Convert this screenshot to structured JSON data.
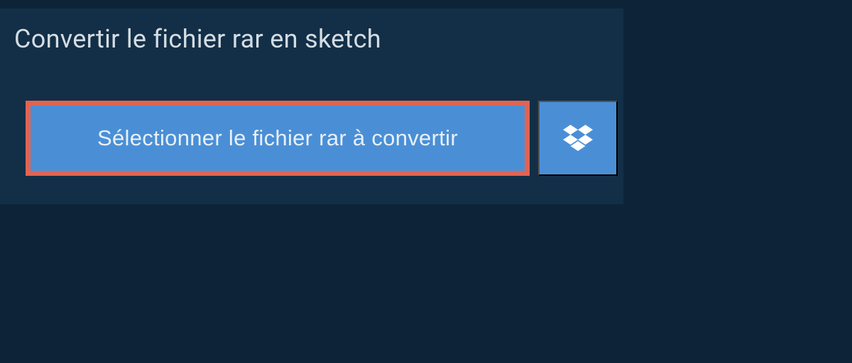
{
  "header": {
    "title": "Convertir le fichier rar en sketch"
  },
  "buttons": {
    "select_label": "Sélectionner le fichier rar à convertir"
  }
}
